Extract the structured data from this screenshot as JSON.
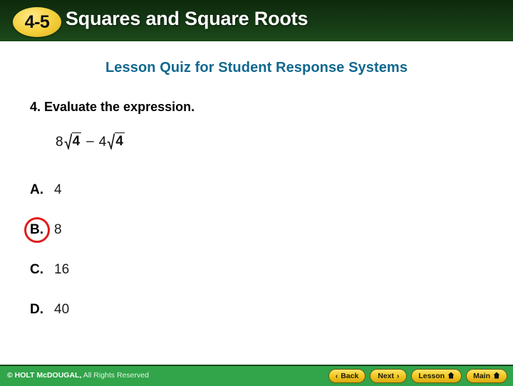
{
  "header": {
    "badge": "4-5",
    "title": "Squares and Square Roots",
    "bg_color": "#143613",
    "badge_color": "#f5d23f"
  },
  "quiz": {
    "subtitle": "Lesson Quiz for Student Response Systems",
    "subtitle_color": "#10688f",
    "question_number": "4.",
    "question": "4. Evaluate the expression.",
    "expression": {
      "plain": "8√4 – 4√4",
      "term1_coefficient": "8",
      "term1_radicand": "4",
      "operator": "–",
      "term2_coefficient": "4",
      "term2_radicand": "4"
    },
    "choices": [
      {
        "label": "A.",
        "value": "4",
        "selected": false
      },
      {
        "label": "B.",
        "value": "8",
        "selected": true
      },
      {
        "label": "C.",
        "value": "16",
        "selected": false
      },
      {
        "label": "D.",
        "value": "40",
        "selected": false
      }
    ],
    "selected_choice": "B",
    "highlight_color": "#e11b1b"
  },
  "footer": {
    "copyright_brand": "© HOLT McDOUGAL,",
    "copyright_rights": " All Rights Reserved",
    "bg_color": "#32a44a",
    "buttons": [
      {
        "label": "Back",
        "icon": "chevron-left-icon",
        "glyph": "‹",
        "icon_side": "left"
      },
      {
        "label": "Next",
        "icon": "chevron-right-icon",
        "glyph": "›",
        "icon_side": "right"
      },
      {
        "label": "Lesson",
        "icon": "home-icon",
        "glyph": "⌂",
        "icon_side": "right"
      },
      {
        "label": "Main",
        "icon": "home-icon",
        "glyph": "⌂",
        "icon_side": "right"
      }
    ]
  }
}
